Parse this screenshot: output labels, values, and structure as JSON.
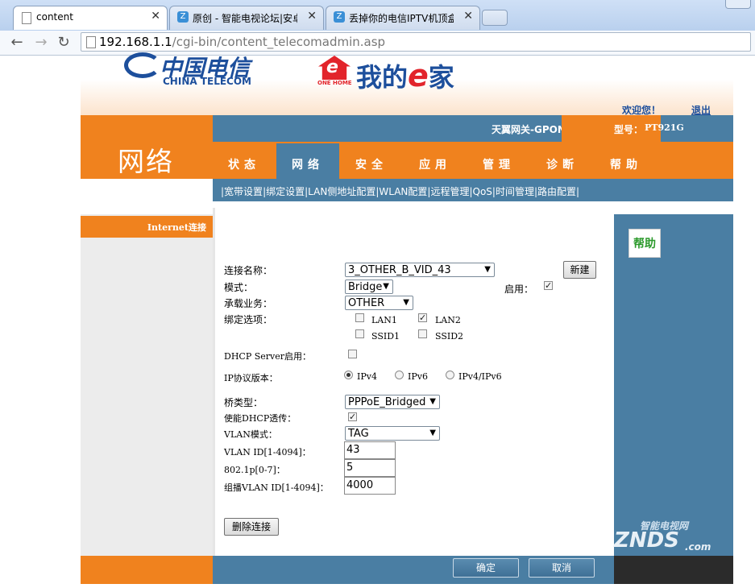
{
  "browser": {
    "tabs": [
      {
        "title": "content"
      },
      {
        "title": "原创 - 智能电视论坛|安卓"
      },
      {
        "title": "丢掉你的电信IPTV机顶盒"
      }
    ],
    "close_glyph": "✕",
    "url_host": "192.168.1.1",
    "url_path": "/cgi-bin/content_telecomadmin.asp"
  },
  "header": {
    "logo_cn": "中国电信",
    "logo_en": "CHINA TELECOM",
    "ehome_small": "ONE HOME",
    "ehome_title_a": "我的",
    "ehome_title_e": "e",
    "ehome_title_b": "家",
    "welcome": "欢迎您！",
    "logout": "退出",
    "gateway_name": "天翼网关-GPON",
    "model_label": "型号：",
    "model_value": "PT921G",
    "section_title": "网络"
  },
  "nav": {
    "tabs": [
      "状态",
      "网络",
      "安全",
      "应用",
      "管理",
      "诊断",
      "帮助"
    ],
    "active": "网络",
    "subnav": [
      "宽带设置",
      "绑定设置",
      "LAN侧地址配置",
      "WLAN配置",
      "远程管理",
      "QoS",
      "时间管理",
      "路由配置"
    ]
  },
  "sidebar": {
    "item": "Internet连接"
  },
  "help": {
    "label": "帮助"
  },
  "form": {
    "conn_name_label": "连接名称：",
    "conn_name_value": "3_OTHER_B_VID_43",
    "new_button": "新建",
    "mode_label": "模式：",
    "mode_value": "Bridge",
    "enable_label": "启用：",
    "service_label": "承载业务：",
    "service_value": "OTHER",
    "bind_label": "绑定选项：",
    "lan1": "LAN1",
    "lan2": "LAN2",
    "ssid1": "SSID1",
    "ssid2": "SSID2",
    "dhcp_server_label": "DHCP Server启用：",
    "ip_version_label": "IP协议版本：",
    "ipv4": "IPv4",
    "ipv6": "IPv6",
    "ipv46": "IPv4/IPv6",
    "bridge_type_label": "桥类型：",
    "bridge_type_value": "PPPoE_Bridged",
    "dhcp_passthru_label": "使能DHCP透传：",
    "vlan_mode_label": "VLAN模式：",
    "vlan_mode_value": "TAG",
    "vlan_id_label": "VLAN ID[1-4094]：",
    "vlan_id_value": "43",
    "p8021_label": "802.1p[0-7]：",
    "p8021_value": "5",
    "mcast_vlan_label": "组播VLAN ID[1-4094]：",
    "mcast_vlan_value": "4000",
    "delete_button": "删除连接"
  },
  "footer": {
    "ok": "确定",
    "cancel": "取消"
  },
  "watermark": {
    "cn": "智能电视网",
    "en": "ZNDS",
    "suffix": ".com"
  },
  "colors": {
    "orange": "#f0821e",
    "blue": "#4a7ea3",
    "telecom_blue": "#1d4f9c",
    "ehome_red": "#e2242b"
  }
}
